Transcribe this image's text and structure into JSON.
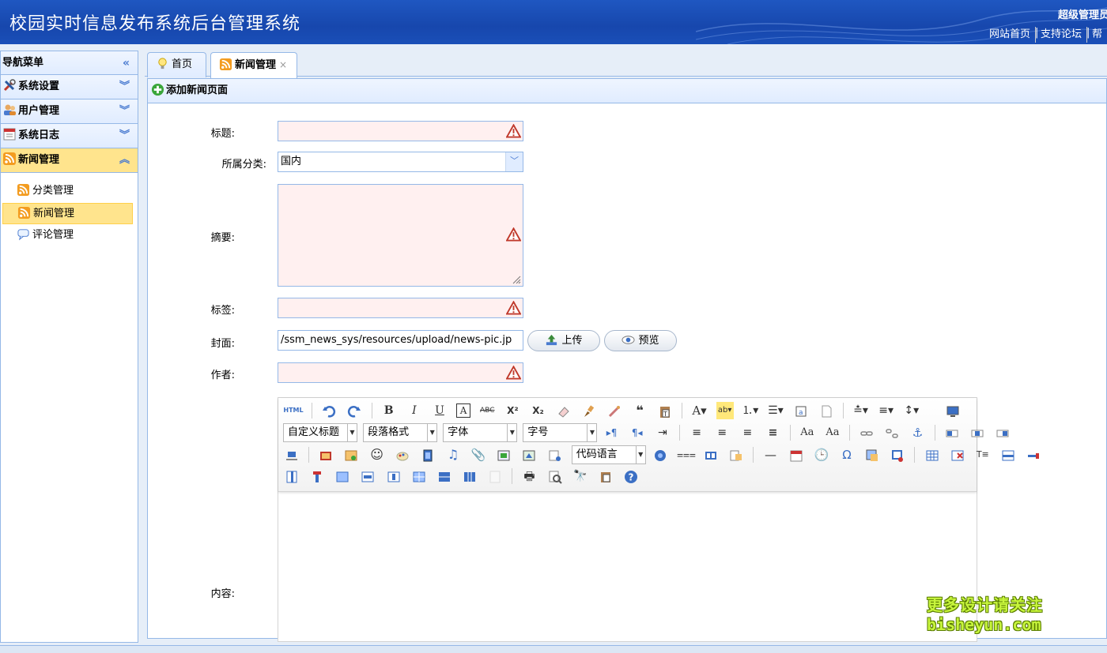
{
  "header": {
    "title": "校园实时信息发布系统后台管理系统",
    "user": "超级管理员",
    "links": [
      "网站首页",
      "支持论坛",
      "帮"
    ]
  },
  "sidebar": {
    "title": "导航菜单",
    "collapse_glyph": "«",
    "groups": [
      {
        "label": "系统设置",
        "icon": "tools-icon",
        "expanded": false
      },
      {
        "label": "用户管理",
        "icon": "users-icon",
        "expanded": false
      },
      {
        "label": "系统日志",
        "icon": "log-icon",
        "expanded": false
      },
      {
        "label": "新闻管理",
        "icon": "rss-icon",
        "expanded": true
      }
    ],
    "items": [
      {
        "label": "分类管理",
        "icon": "rss-icon",
        "active": false
      },
      {
        "label": "新闻管理",
        "icon": "rss-icon",
        "active": true
      },
      {
        "label": "评论管理",
        "icon": "comment-icon",
        "active": false
      }
    ]
  },
  "tabs": [
    {
      "label": "首页",
      "icon": "bulb-icon",
      "active": false
    },
    {
      "label": "新闻管理",
      "icon": "rss-icon",
      "active": true,
      "close": "×"
    }
  ],
  "panel": {
    "title": "添加新闻页面",
    "form": {
      "title_label": "标题:",
      "category_label": "所属分类:",
      "category_value": "国内",
      "summary_label": "摘要:",
      "tags_label": "标签:",
      "cover_label": "封面:",
      "cover_value": "/ssm_news_sys/resources/upload/news-pic.jp",
      "upload_button": "上传",
      "preview_button": "预览",
      "author_label": "作者:",
      "content_label": "内容:"
    },
    "editor": {
      "html_button": "HTML",
      "selects": {
        "custom_title": "自定义标题",
        "paragraph": "段落格式",
        "font": "字体",
        "size": "字号",
        "code_lang": "代码语言"
      }
    }
  },
  "watermark": {
    "line1": "更多设计请关注",
    "line2": "bisheyun.com"
  },
  "colors": {
    "header_bg": "#1a4fb8",
    "panel_border": "#95b8e7",
    "active_item": "#ffe48d",
    "invalid_field": "#fff0f0"
  }
}
